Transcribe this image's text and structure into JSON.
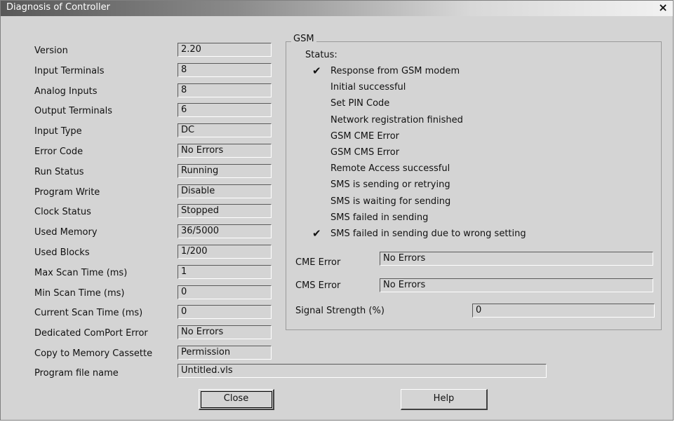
{
  "window": {
    "title": "Diagnosis of Controller",
    "close_glyph": "×"
  },
  "info": [
    {
      "label": "Version",
      "value": "2.20"
    },
    {
      "label": "Input Terminals",
      "value": "8"
    },
    {
      "label": "Analog Inputs",
      "value": "8"
    },
    {
      "label": "Output Terminals",
      "value": "6"
    },
    {
      "label": "Input Type",
      "value": "DC"
    },
    {
      "label": "Error Code",
      "value": "No Errors"
    },
    {
      "label": "Run Status",
      "value": "Running"
    },
    {
      "label": "Program Write",
      "value": "Disable"
    },
    {
      "label": "Clock Status",
      "value": "Stopped"
    },
    {
      "label": "Used Memory",
      "value": "36/5000"
    },
    {
      "label": "Used Blocks",
      "value": "1/200"
    },
    {
      "label": "Max Scan Time (ms)",
      "value": "1"
    },
    {
      "label": "Min Scan Time (ms)",
      "value": "0"
    },
    {
      "label": "Current Scan Time (ms)",
      "value": "0"
    },
    {
      "label": "Dedicated ComPort Error",
      "value": "No Errors"
    },
    {
      "label": "Copy to Memory Cassette",
      "value": "Permission"
    }
  ],
  "program_file": {
    "label": "Program file name",
    "value": "Untitled.vls"
  },
  "gsm": {
    "title": "GSM",
    "status_label": "Status:",
    "statuses": [
      {
        "text": "Response from GSM modem",
        "checked": true
      },
      {
        "text": "Initial successful",
        "checked": false
      },
      {
        "text": "Set PIN Code",
        "checked": false
      },
      {
        "text": "Network registration finished",
        "checked": false
      },
      {
        "text": "GSM CME Error",
        "checked": false
      },
      {
        "text": "GSM CMS Error",
        "checked": false
      },
      {
        "text": "Remote Access successful",
        "checked": false
      },
      {
        "text": "SMS is sending or retrying",
        "checked": false
      },
      {
        "text": "SMS is waiting for sending",
        "checked": false
      },
      {
        "text": "SMS failed in sending",
        "checked": false
      },
      {
        "text": "SMS failed in sending due to wrong setting",
        "checked": true
      }
    ],
    "check_glyph": "✔",
    "cme_error": {
      "label": "CME Error",
      "value": "No Errors"
    },
    "cms_error": {
      "label": "CMS Error",
      "value": "No Errors"
    },
    "signal_strength": {
      "label": "Signal Strength (%)",
      "value": "0"
    }
  },
  "buttons": {
    "close": "Close",
    "help": "Help"
  }
}
